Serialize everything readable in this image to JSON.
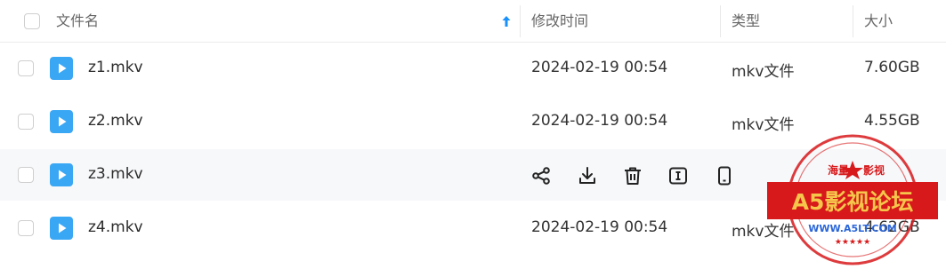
{
  "header": {
    "name_label": "文件名",
    "modified_label": "修改时间",
    "type_label": "类型",
    "size_label": "大小",
    "sort_icon": "arrow-up-icon"
  },
  "files": [
    {
      "name": "z1.mkv",
      "modified": "2024-02-19 00:54",
      "type": "mkv文件",
      "size": "7.60GB"
    },
    {
      "name": "z2.mkv",
      "modified": "2024-02-19 00:54",
      "type": "mkv文件",
      "size": "4.55GB"
    },
    {
      "name": "z3.mkv",
      "modified": "",
      "type": "",
      "size": ""
    },
    {
      "name": "z4.mkv",
      "modified": "2024-02-19 00:54",
      "type": "mkv文件",
      "size": "4.62GB"
    }
  ],
  "row_actions": [
    "share-icon",
    "download-icon",
    "delete-icon",
    "rename-icon",
    "mobile-icon"
  ],
  "watermark": {
    "top_text": "海量",
    "top_text2": "影视",
    "main_text": "A5影视论坛",
    "url_text": "WWW.A5LT.COM"
  },
  "colors": {
    "accent": "#1890ff",
    "file_icon": "#3aa7f5",
    "stamp_red": "#d7191b",
    "stamp_banner": "#f6c64b"
  }
}
